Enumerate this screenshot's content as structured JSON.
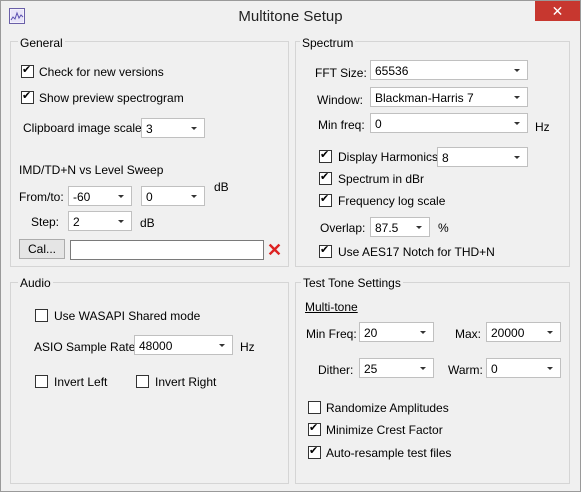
{
  "window": {
    "title": "Multitone Setup",
    "close": "✕",
    "icon": "spectrogram-app-icon"
  },
  "general": {
    "title": "General",
    "check_new_versions": {
      "label": "Check for new versions",
      "checked": true
    },
    "show_preview": {
      "label": "Show preview spectrogram",
      "checked": true
    },
    "clipboard_scale": {
      "label": "Clipboard image scale:",
      "value": "3"
    },
    "sweep_title": "IMD/TD+N vs Level Sweep",
    "from_to": {
      "label": "From/to:",
      "from": "-60",
      "to": "0",
      "unit": "dB"
    },
    "step": {
      "label": "Step:",
      "value": "2",
      "unit": "dB"
    },
    "cal_button": "Cal...",
    "cal_value": ""
  },
  "spectrum": {
    "title": "Spectrum",
    "fft_size": {
      "label": "FFT Size:",
      "value": "65536"
    },
    "window": {
      "label": "Window:",
      "value": "Blackman-Harris 7"
    },
    "min_freq": {
      "label": "Min freq:",
      "value": "0",
      "unit": "Hz"
    },
    "display_harmonics": {
      "label": "Display Harmonics",
      "checked": true,
      "value": "8"
    },
    "spectrum_dbr": {
      "label": "Spectrum in dBr",
      "checked": true
    },
    "freq_log": {
      "label": "Frequency log scale",
      "checked": true
    },
    "overlap": {
      "label": "Overlap:",
      "value": "87.5",
      "unit": "%"
    },
    "aes17": {
      "label": "Use AES17 Notch for THD+N",
      "checked": true
    }
  },
  "audio": {
    "title": "Audio",
    "wasapi": {
      "label": "Use WASAPI Shared mode",
      "checked": false
    },
    "asio_rate": {
      "label": "ASIO Sample Rate:",
      "value": "48000",
      "unit": "Hz"
    },
    "invert_left": {
      "label": "Invert Left",
      "checked": false
    },
    "invert_right": {
      "label": "Invert Right",
      "checked": false
    }
  },
  "test_tone": {
    "title": "Test Tone Settings",
    "subtitle": "Multi-tone",
    "min_freq": {
      "label": "Min Freq:",
      "value": "20"
    },
    "max": {
      "label": "Max:",
      "value": "20000"
    },
    "dither": {
      "label": "Dither:",
      "value": "25"
    },
    "warm": {
      "label": "Warm:",
      "value": "0"
    },
    "randomize": {
      "label": "Randomize Amplitudes",
      "checked": false
    },
    "minimize_crest": {
      "label": "Minimize Crest Factor",
      "checked": true
    },
    "auto_resample": {
      "label": "Auto-resample test files",
      "checked": true
    }
  }
}
